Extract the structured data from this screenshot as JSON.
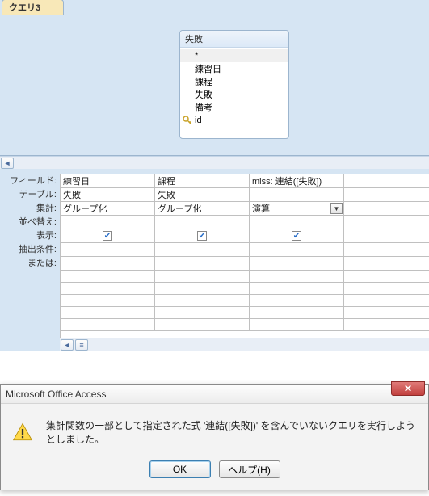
{
  "tab": {
    "label": "クエリ3"
  },
  "tableBox": {
    "title": "失敗",
    "fields": [
      "*",
      "練習日",
      "課程",
      "失敗",
      "備考",
      "id"
    ],
    "selectedIndex": 0,
    "pkIndex": 5
  },
  "gridLabels": {
    "field": "フィールド:",
    "table": "テーブル:",
    "total": "集計:",
    "sort": "並べ替え:",
    "show": "表示:",
    "criteria": "抽出条件:",
    "or": "または:"
  },
  "columns": [
    {
      "field": "練習日",
      "table": "失敗",
      "total": "グループ化",
      "show": true
    },
    {
      "field": "課程",
      "table": "失敗",
      "total": "グループ化",
      "show": true
    },
    {
      "field": "miss: 連結([失敗])",
      "table": "",
      "total": "演算",
      "show": true,
      "dropdown": true
    }
  ],
  "dialog": {
    "title": "Microsoft Office Access",
    "message": "集計関数の一部として指定された式 '連結([失敗])' を含んでいないクエリを実行しようとしました。",
    "ok": "OK",
    "help": "ヘルプ(H)"
  }
}
